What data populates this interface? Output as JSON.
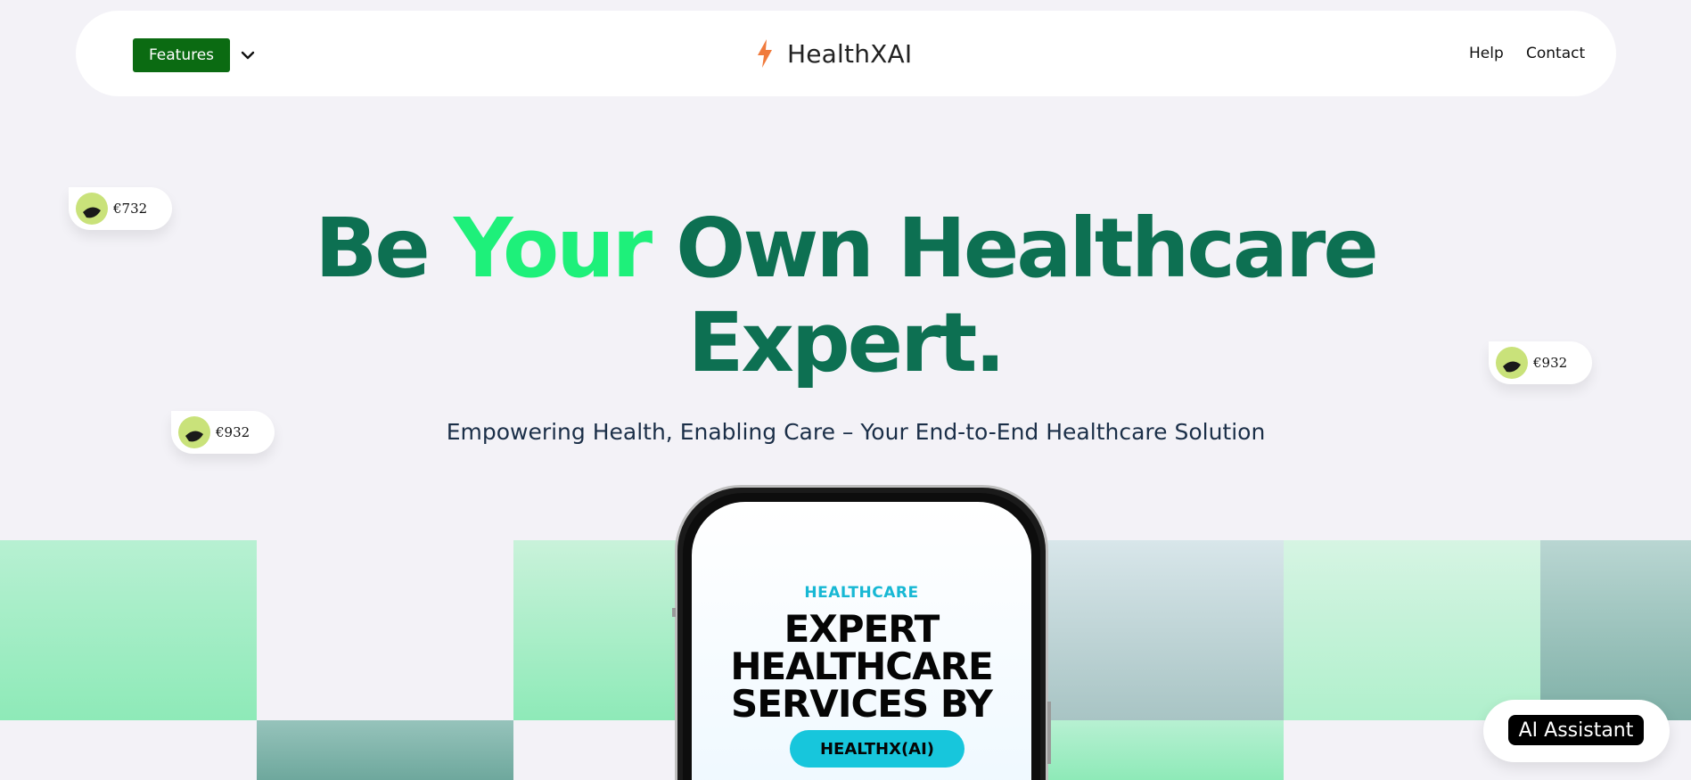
{
  "header": {
    "features_label": "Features",
    "brand_name": "HealthXAI",
    "nav": [
      "Help",
      "Contact"
    ]
  },
  "chips": [
    "€732",
    "€932",
    "€932"
  ],
  "hero": {
    "title_part1": "Be ",
    "title_accent": "Your",
    "title_part2": " Own Healthcare",
    "title_line2": "Expert.",
    "subtitle": "Empowering Health, Enabling Care – Your End-to-End Healthcare Solution"
  },
  "phone_screen": {
    "kicker": "HEALTHCARE",
    "headline_lines": [
      "EXPERT",
      "HEALTHCARE",
      "SERVICES BY"
    ],
    "pill": "HEALTHX(AI)"
  },
  "assistant": {
    "label": "AI Assistant"
  },
  "colors": {
    "brand_green": "#0b6b12",
    "heading_green": "#0d7052",
    "accent_green": "#1ef07a",
    "cyan": "#17c6dc",
    "brand_icon": "#f07a3c"
  },
  "icons": {
    "features_chevron": "chevron-down-icon",
    "brand_logo": "lightning-bolt-icon",
    "chip_avatar": "avatar-icon"
  }
}
